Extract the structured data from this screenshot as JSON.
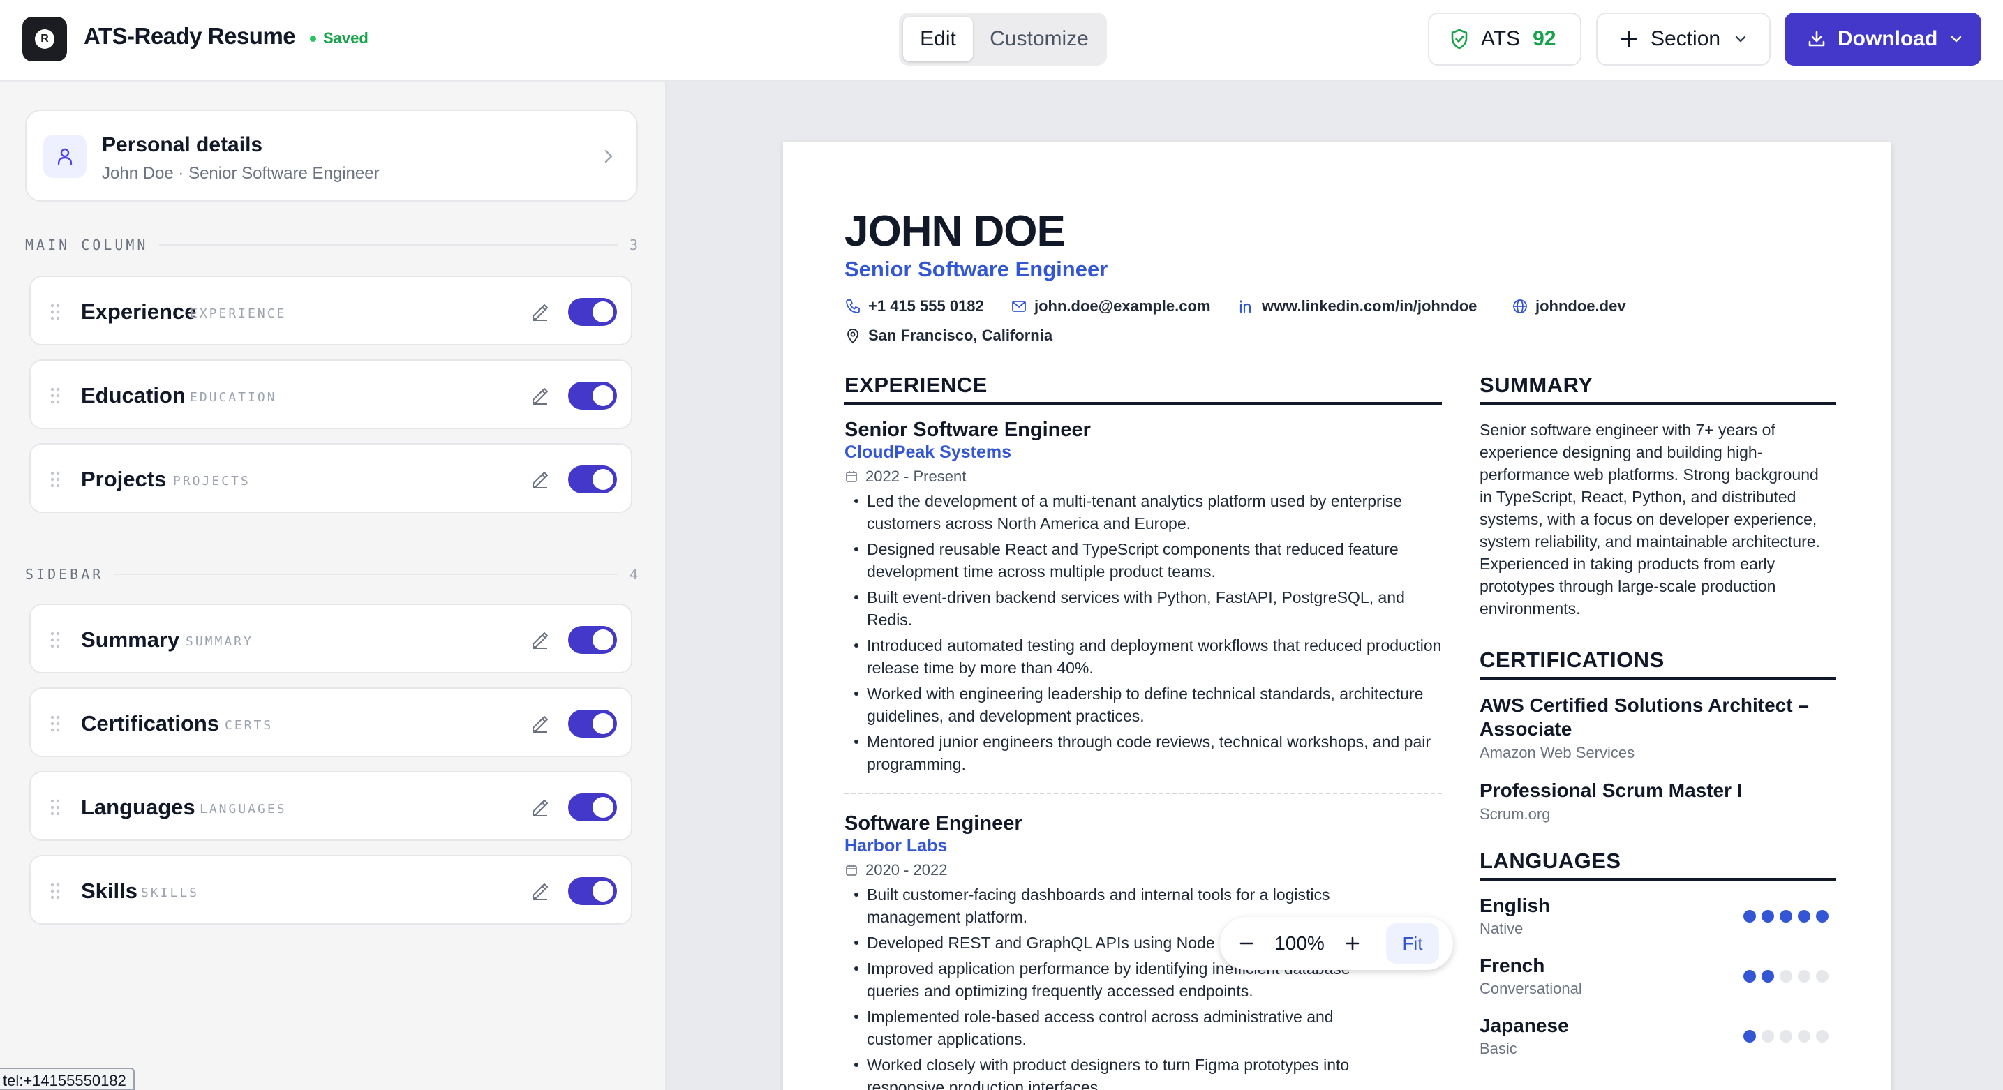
{
  "app": {
    "title": "ATS-Ready Resume",
    "saved_label": "Saved",
    "logo_letter": "R"
  },
  "modes": {
    "edit": "Edit",
    "customize": "Customize",
    "active": "Edit"
  },
  "toolbar": {
    "ats_label": "ATS",
    "ats_score": "92",
    "section_label": "Section",
    "download_label": "Download"
  },
  "personal": {
    "title": "Personal details",
    "subtitle": "John Doe · Senior Software Engineer"
  },
  "groups": {
    "main": {
      "label": "MAIN COLUMN",
      "count": "3"
    },
    "sidebar": {
      "label": "SIDEBAR",
      "count": "4"
    }
  },
  "sections": [
    {
      "name": "Experience",
      "tag": "EXPERIENCE",
      "enabled": true
    },
    {
      "name": "Education",
      "tag": "EDUCATION",
      "enabled": true
    },
    {
      "name": "Projects",
      "tag": "PROJECTS",
      "enabled": true
    },
    {
      "name": "Summary",
      "tag": "SUMMARY",
      "enabled": true
    },
    {
      "name": "Certifications",
      "tag": "CERTS",
      "enabled": true
    },
    {
      "name": "Languages",
      "tag": "LANGUAGES",
      "enabled": true
    },
    {
      "name": "Skills",
      "tag": "SKILLS",
      "enabled": true
    }
  ],
  "status_link": "tel:+14155550182",
  "resume": {
    "name": "JOHN DOE",
    "title": "Senior Software Engineer",
    "phone": "+1 415 555 0182",
    "email": "john.doe@example.com",
    "linkedin": "www.linkedin.com/in/johndoe",
    "website": "johndoe.dev",
    "location": "San Francisco, California",
    "headings": {
      "experience": "EXPERIENCE",
      "summary": "SUMMARY",
      "certifications": "CERTIFICATIONS",
      "languages": "LANGUAGES"
    },
    "jobs": [
      {
        "title": "Senior Software Engineer",
        "company": "CloudPeak Systems",
        "dates": "2022 - Present",
        "bullets": [
          "Led the development of a multi-tenant analytics platform used by enterprise customers across North America and Europe.",
          "Designed reusable React and TypeScript components that reduced feature development time across multiple product teams.",
          "Built event-driven backend services with Python, FastAPI, PostgreSQL, and Redis.",
          "Introduced automated testing and deployment workflows that reduced production release time by more than 40%.",
          "Worked with engineering leadership to define technical standards, architecture guidelines, and development practices.",
          "Mentored junior engineers through code reviews, technical workshops, and pair programming."
        ]
      },
      {
        "title": "Software Engineer",
        "company": "Harbor Labs",
        "dates": "2020 - 2022",
        "bullets": [
          "Built customer-facing dashboards and internal tools for a logistics management platform.",
          "Developed REST and GraphQL APIs using Node",
          "Improved application performance by identifying inefficient database queries and optimizing frequently accessed endpoints.",
          "Implemented role-based access control across administrative and customer applications.",
          "Worked closely with product designers to turn Figma prototypes into responsive production interfaces."
        ]
      }
    ],
    "summary": "Senior software engineer with 7+ years of experience designing and building high-performance web platforms. Strong background in TypeScript, React, Python, and distributed systems, with a focus on developer experience, system reliability, and maintainable architecture. Experienced in taking products from early prototypes through large-scale production environments.",
    "certifications": [
      {
        "name": "AWS Certified Solutions Architect – Associate",
        "issuer": "Amazon Web Services"
      },
      {
        "name": "Professional Scrum Master I",
        "issuer": "Scrum.org"
      }
    ],
    "languages": [
      {
        "name": "English",
        "level": "Native",
        "dots": 5
      },
      {
        "name": "French",
        "level": "Conversational",
        "dots": 2
      },
      {
        "name": "Japanese",
        "level": "Basic",
        "dots": 1
      }
    ]
  },
  "zoom": {
    "value": "100%",
    "fit_label": "Fit"
  },
  "colors": {
    "accent": "#4338ca",
    "link_blue": "#3356d4",
    "success": "#16a34a"
  }
}
